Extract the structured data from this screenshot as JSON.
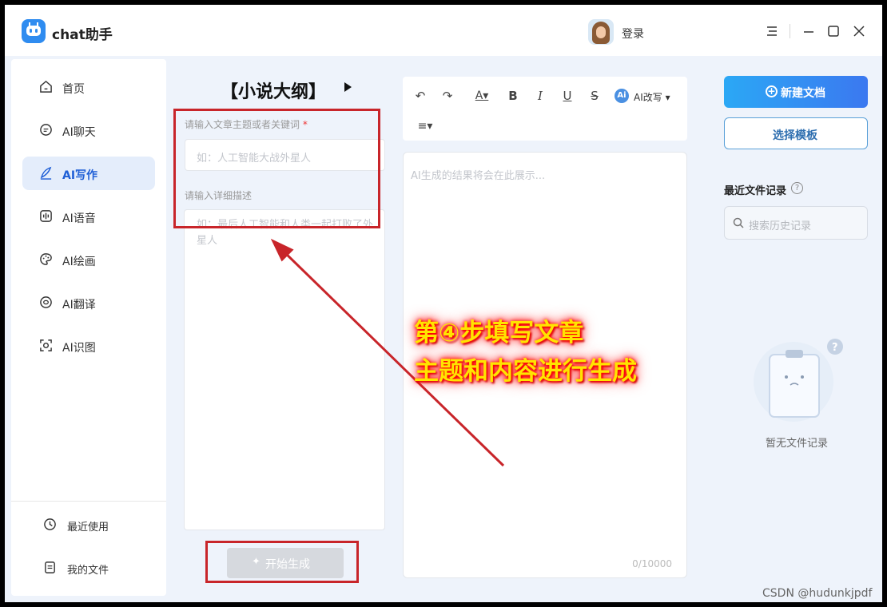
{
  "app": {
    "title": "chat助手",
    "login_label": "登录"
  },
  "sidebar": {
    "items": [
      {
        "label": "首页",
        "icon": "home-icon"
      },
      {
        "label": "AI聊天",
        "icon": "chat-icon"
      },
      {
        "label": "AI写作",
        "icon": "pen-icon",
        "active": true
      },
      {
        "label": "AI语音",
        "icon": "voice-icon"
      },
      {
        "label": "AI绘画",
        "icon": "palette-icon"
      },
      {
        "label": "AI翻译",
        "icon": "translate-icon"
      },
      {
        "label": "AI识图",
        "icon": "scan-icon"
      }
    ],
    "bottom": [
      {
        "label": "最近使用",
        "icon": "history-icon"
      },
      {
        "label": "我的文件",
        "icon": "file-icon"
      }
    ]
  },
  "form": {
    "title": "【小说大纲】",
    "topic_label": "请输入文章主题或者关键词",
    "topic_required": "*",
    "topic_placeholder": "如：人工智能大战外星人",
    "detail_label": "请输入详细描述",
    "detail_placeholder": "如：最后人工智能和人类一起打败了外星人",
    "generate_label": "开始生成"
  },
  "editor": {
    "ai_rewrite_label": "AI改写",
    "placeholder": "AI生成的结果将会在此展示...",
    "counter": "0/10000"
  },
  "right_panel": {
    "new_doc_label": "新建文档",
    "template_label": "选择模板",
    "recent_title": "最近文件记录",
    "search_placeholder": "搜索历史记录",
    "empty_text": "暂无文件记录"
  },
  "annotation": {
    "line1": "第④步填写文章",
    "line2": "主题和内容进行生成",
    "color": "#c8252a"
  },
  "watermark": "CSDN @hudunkjpdf"
}
